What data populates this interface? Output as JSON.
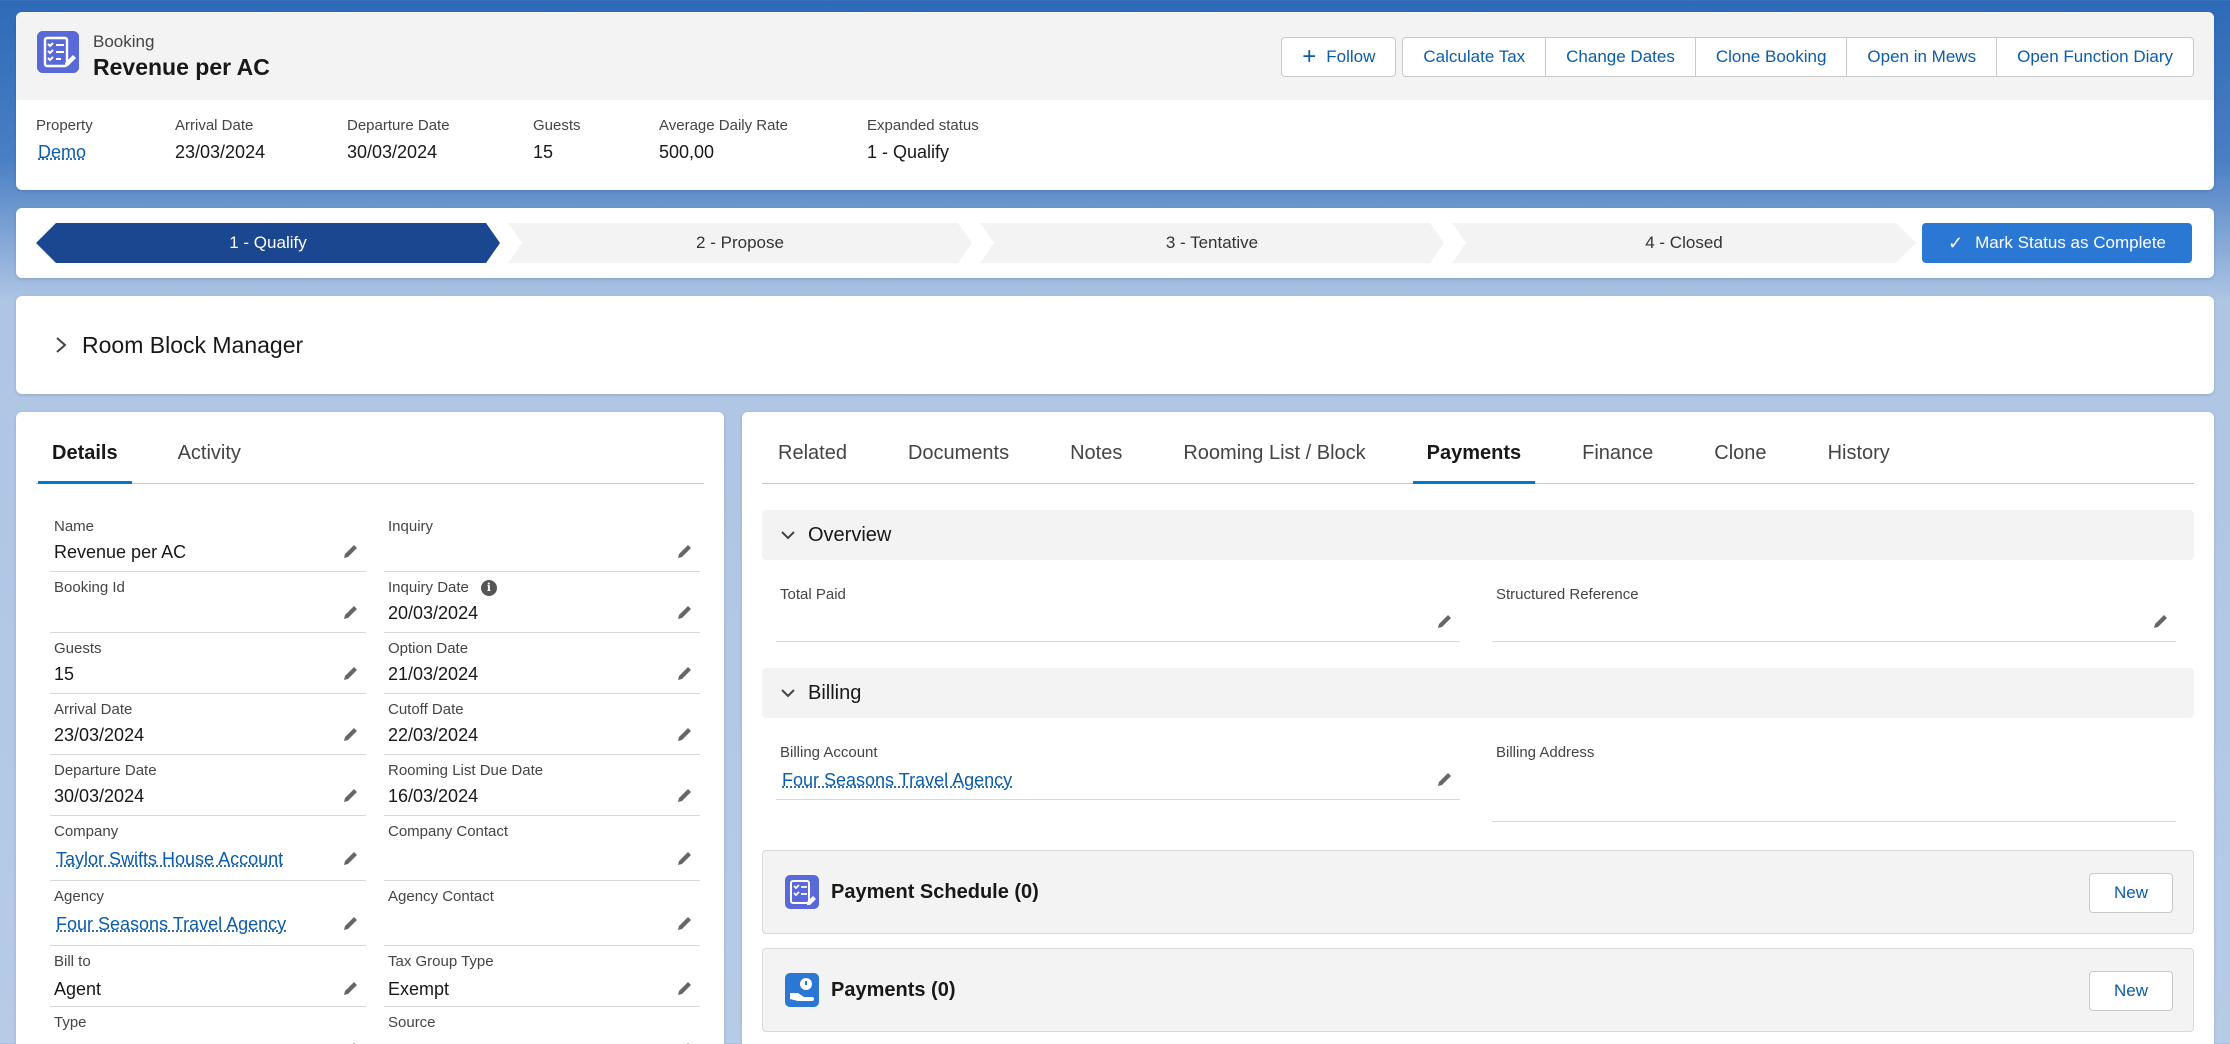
{
  "header": {
    "object_type": "Booking",
    "title": "Revenue per AC",
    "follow_label": "Follow",
    "actions": [
      "Calculate Tax",
      "Change Dates",
      "Clone Booking",
      "Open in Mews",
      "Open Function Diary"
    ]
  },
  "highlights": [
    {
      "label": "Property",
      "value": "Demo"
    },
    {
      "label": "Arrival Date",
      "value": "23/03/2024"
    },
    {
      "label": "Departure Date",
      "value": "30/03/2024"
    },
    {
      "label": "Guests",
      "value": "15"
    },
    {
      "label": "Average Daily Rate",
      "value": "500,00"
    },
    {
      "label": "Expanded status",
      "value": "1 - Qualify"
    }
  ],
  "path": {
    "steps": [
      "1 - Qualify",
      "2 - Propose",
      "3 - Tentative",
      "4 - Closed"
    ],
    "mark_complete_label": "Mark Status as Complete"
  },
  "room_block": {
    "title": "Room Block Manager"
  },
  "details": {
    "tabs": [
      "Details",
      "Activity"
    ],
    "fields": [
      {
        "label": "Name",
        "value": "Revenue per AC"
      },
      {
        "label": "Inquiry",
        "value": ""
      },
      {
        "label": "Booking Id",
        "value": ""
      },
      {
        "label": "Inquiry Date",
        "value": "20/03/2024"
      },
      {
        "label": "Guests",
        "value": "15"
      },
      {
        "label": "Option Date",
        "value": "21/03/2024"
      },
      {
        "label": "Arrival Date",
        "value": "23/03/2024"
      },
      {
        "label": "Cutoff Date",
        "value": "22/03/2024"
      },
      {
        "label": "Departure Date",
        "value": "30/03/2024"
      },
      {
        "label": "Rooming List Due Date",
        "value": "16/03/2024"
      },
      {
        "label": "Company",
        "value": "Taylor Swifts House Account"
      },
      {
        "label": "Company Contact",
        "value": ""
      },
      {
        "label": "Agency",
        "value": "Four Seasons Travel Agency"
      },
      {
        "label": "Agency Contact",
        "value": ""
      },
      {
        "label": "Bill to",
        "value": "Agent"
      },
      {
        "label": "Tax Group Type",
        "value": "Exempt"
      },
      {
        "label": "Type",
        "value": ""
      },
      {
        "label": "Source",
        "value": ""
      }
    ]
  },
  "payments": {
    "tabs": [
      "Related",
      "Documents",
      "Notes",
      "Rooming List / Block",
      "Payments",
      "Finance",
      "Clone",
      "History"
    ],
    "overview": {
      "title": "Overview",
      "total_paid_label": "Total Paid",
      "total_paid_value": "",
      "structured_ref_label": "Structured Reference",
      "structured_ref_value": ""
    },
    "billing": {
      "title": "Billing",
      "account_label": "Billing Account",
      "account_value": "Four Seasons Travel Agency",
      "address_label": "Billing Address",
      "address_value": ""
    },
    "related": [
      {
        "title": "Payment Schedule (0)",
        "new_label": "New"
      },
      {
        "title": "Payments (0)",
        "new_label": "New"
      }
    ]
  },
  "colors": {
    "brand": "#1b4690",
    "accent": "#2b78d4",
    "link": "#0b5cab",
    "icon_bg": "#596ad8"
  }
}
